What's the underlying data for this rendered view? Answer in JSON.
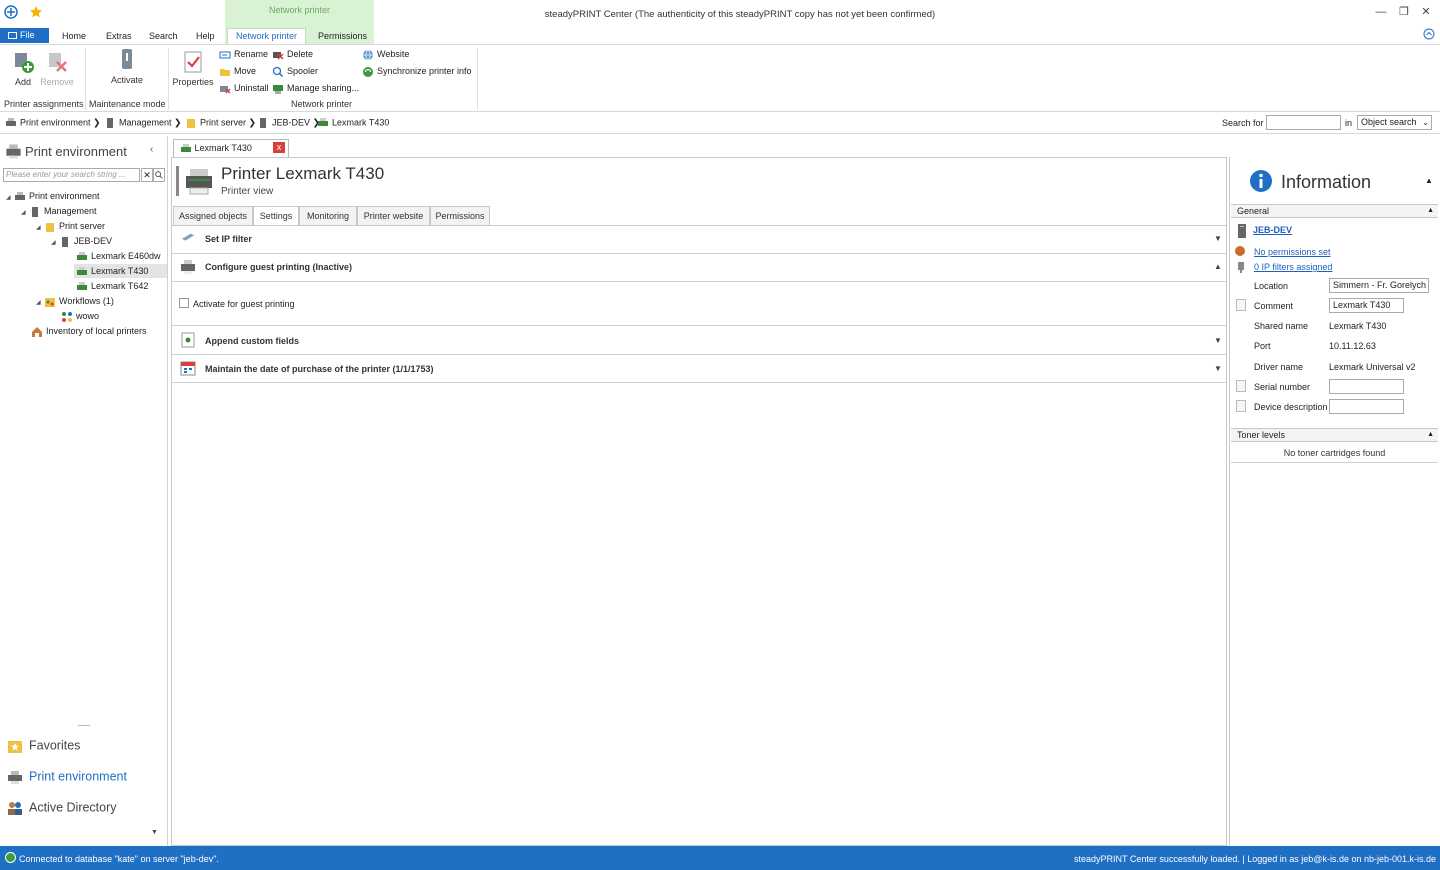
{
  "window": {
    "title": "steadyPRINT Center (The authenticity of this steadyPRINT copy has not yet been confirmed)",
    "context_tab_group": "Network printer"
  },
  "ribbon_tabs": {
    "file": "File",
    "home": "Home",
    "extras": "Extras",
    "search": "Search",
    "help": "Help",
    "network_printer": "Network printer",
    "permissions": "Permissions"
  },
  "ribbon": {
    "add": "Add",
    "remove": "Remove",
    "activate": "Activate",
    "properties": "Properties",
    "rename": "Rename",
    "move": "Move",
    "uninstall": "Uninstall",
    "delete": "Delete",
    "spooler": "Spooler",
    "manage_sharing": "Manage sharing...",
    "website": "Website",
    "sync_info": "Synchronize printer info",
    "group_printer_assignments": "Printer assignments",
    "group_maintenance": "Maintenance mode",
    "group_network_printer": "Network printer"
  },
  "breadcrumb": {
    "items": [
      "Print environment",
      "Management",
      "Print server",
      "JEB-DEV",
      "Lexmark T430"
    ],
    "search_for": "Search for",
    "in": "in",
    "object_search": "Object search"
  },
  "left_panel": {
    "title": "Print environment",
    "search_placeholder": "Please enter your search string ...",
    "tree": {
      "root": "Print environment",
      "management": "Management",
      "print_server": "Print server",
      "server": "JEB-DEV",
      "printers": [
        "Lexmark E460dw",
        "Lexmark T430",
        "Lexmark T642"
      ],
      "workflows": "Workflows (1)",
      "workflow_item": "wowo",
      "inventory": "Inventory of local printers"
    },
    "nav": {
      "favorites": "Favorites",
      "print_environment": "Print environment",
      "active_directory": "Active Directory"
    }
  },
  "document_tab": {
    "label": "Lexmark T430",
    "close": "x"
  },
  "main": {
    "title": "Printer Lexmark T430",
    "subtitle": "Printer view",
    "tabs": [
      "Assigned objects",
      "Settings",
      "Monitoring",
      "Printer website",
      "Permissions"
    ],
    "active_tab": "Settings",
    "sections": {
      "ip_filter": "Set IP filter",
      "guest_printing": "Configure guest printing (Inactive)",
      "guest_checkbox": "Activate for guest printing",
      "custom_fields": "Append custom fields",
      "purchase_date": "Maintain the date of purchase of the printer (1/1/1753)"
    }
  },
  "info_panel": {
    "title": "Information",
    "general_header": "General",
    "server_link": "JEB-DEV",
    "permissions_link": "No permissions set",
    "ip_filters_link": "0 IP filters assigned",
    "labels": {
      "location": "Location",
      "comment": "Comment",
      "shared_name": "Shared name",
      "port": "Port",
      "driver_name": "Driver name",
      "serial_number": "Serial number",
      "device_description": "Device description"
    },
    "values": {
      "location": "Simmern - Fr. Gorelych",
      "comment": "Lexmark T430",
      "shared_name": "Lexmark T430",
      "port": "10.11.12.63",
      "driver_name": "Lexmark Universal v2",
      "serial_number": "",
      "device_description": ""
    },
    "toner_header": "Toner levels",
    "toner_message": "No toner cartridges found"
  },
  "status_bar": {
    "left": "Connected to database \"kate\" on server \"jeb-dev\".",
    "right": "steadyPRINT Center successfully loaded. | Logged in as jeb@k-is.de on nb-jeb-001.k-is.de"
  },
  "colors": {
    "accent": "#1f6fc5",
    "context_band": "#d9f2d4",
    "link": "#1f5fc4",
    "close_red": "#d9403a"
  }
}
